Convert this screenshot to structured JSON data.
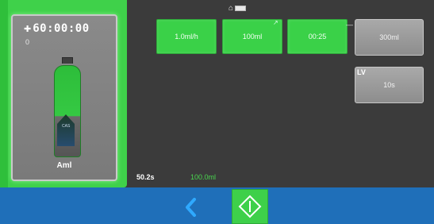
{
  "status": {
    "wifi_icon": "wifi-icon",
    "battery_icon": "battery-icon"
  },
  "syringe_card": {
    "time_icon": "dose-icon",
    "time": "60:00:00",
    "small_mark": "0",
    "plunger_label": "CAS",
    "drug_name": "Aml",
    "drug_sub": ""
  },
  "rate_buttons": [
    {
      "label": "1.0ml/h"
    },
    {
      "label": "100ml"
    },
    {
      "label": "00:25"
    }
  ],
  "side_panels": [
    {
      "tick": "—",
      "label": "300ml"
    },
    {
      "lv": "LV",
      "label": "10s"
    }
  ],
  "info": {
    "left": "50.2s",
    "green": "100.0ml"
  },
  "nav": {
    "back_icon": "chevron-left-icon",
    "start_icon": "start-diamond-icon"
  },
  "colors": {
    "green": "#3ad148",
    "nav_blue": "#1f6fb9",
    "background": "#3b3b3b"
  }
}
